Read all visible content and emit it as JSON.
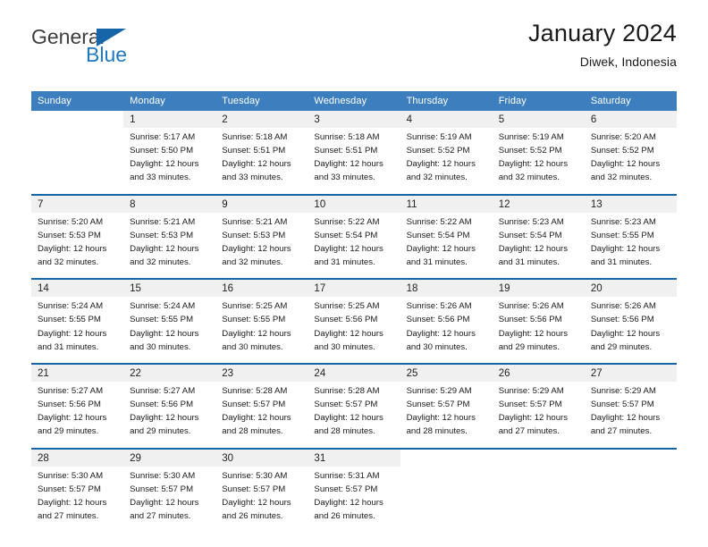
{
  "brand": {
    "name_part1": "General",
    "name_part2": "Blue",
    "flag_icon": "brand-flag-icon"
  },
  "header": {
    "title": "January 2024",
    "location": "Diwek, Indonesia"
  },
  "colors": {
    "header_blue": "#3d7ebf",
    "separator_blue": "#1565a8",
    "daynum_band": "#f0f0f0",
    "brand_blue": "#1f78c1",
    "text": "#1a1a1a"
  },
  "weekday_headers": [
    "Sunday",
    "Monday",
    "Tuesday",
    "Wednesday",
    "Thursday",
    "Friday",
    "Saturday"
  ],
  "weeks": [
    [
      {
        "day": "",
        "sunrise": "",
        "sunset": "",
        "daylight_line1": "",
        "daylight_line2": ""
      },
      {
        "day": "1",
        "sunrise": "Sunrise: 5:17 AM",
        "sunset": "Sunset: 5:50 PM",
        "daylight_line1": "Daylight: 12 hours",
        "daylight_line2": "and 33 minutes."
      },
      {
        "day": "2",
        "sunrise": "Sunrise: 5:18 AM",
        "sunset": "Sunset: 5:51 PM",
        "daylight_line1": "Daylight: 12 hours",
        "daylight_line2": "and 33 minutes."
      },
      {
        "day": "3",
        "sunrise": "Sunrise: 5:18 AM",
        "sunset": "Sunset: 5:51 PM",
        "daylight_line1": "Daylight: 12 hours",
        "daylight_line2": "and 33 minutes."
      },
      {
        "day": "4",
        "sunrise": "Sunrise: 5:19 AM",
        "sunset": "Sunset: 5:52 PM",
        "daylight_line1": "Daylight: 12 hours",
        "daylight_line2": "and 32 minutes."
      },
      {
        "day": "5",
        "sunrise": "Sunrise: 5:19 AM",
        "sunset": "Sunset: 5:52 PM",
        "daylight_line1": "Daylight: 12 hours",
        "daylight_line2": "and 32 minutes."
      },
      {
        "day": "6",
        "sunrise": "Sunrise: 5:20 AM",
        "sunset": "Sunset: 5:52 PM",
        "daylight_line1": "Daylight: 12 hours",
        "daylight_line2": "and 32 minutes."
      }
    ],
    [
      {
        "day": "7",
        "sunrise": "Sunrise: 5:20 AM",
        "sunset": "Sunset: 5:53 PM",
        "daylight_line1": "Daylight: 12 hours",
        "daylight_line2": "and 32 minutes."
      },
      {
        "day": "8",
        "sunrise": "Sunrise: 5:21 AM",
        "sunset": "Sunset: 5:53 PM",
        "daylight_line1": "Daylight: 12 hours",
        "daylight_line2": "and 32 minutes."
      },
      {
        "day": "9",
        "sunrise": "Sunrise: 5:21 AM",
        "sunset": "Sunset: 5:53 PM",
        "daylight_line1": "Daylight: 12 hours",
        "daylight_line2": "and 32 minutes."
      },
      {
        "day": "10",
        "sunrise": "Sunrise: 5:22 AM",
        "sunset": "Sunset: 5:54 PM",
        "daylight_line1": "Daylight: 12 hours",
        "daylight_line2": "and 31 minutes."
      },
      {
        "day": "11",
        "sunrise": "Sunrise: 5:22 AM",
        "sunset": "Sunset: 5:54 PM",
        "daylight_line1": "Daylight: 12 hours",
        "daylight_line2": "and 31 minutes."
      },
      {
        "day": "12",
        "sunrise": "Sunrise: 5:23 AM",
        "sunset": "Sunset: 5:54 PM",
        "daylight_line1": "Daylight: 12 hours",
        "daylight_line2": "and 31 minutes."
      },
      {
        "day": "13",
        "sunrise": "Sunrise: 5:23 AM",
        "sunset": "Sunset: 5:55 PM",
        "daylight_line1": "Daylight: 12 hours",
        "daylight_line2": "and 31 minutes."
      }
    ],
    [
      {
        "day": "14",
        "sunrise": "Sunrise: 5:24 AM",
        "sunset": "Sunset: 5:55 PM",
        "daylight_line1": "Daylight: 12 hours",
        "daylight_line2": "and 31 minutes."
      },
      {
        "day": "15",
        "sunrise": "Sunrise: 5:24 AM",
        "sunset": "Sunset: 5:55 PM",
        "daylight_line1": "Daylight: 12 hours",
        "daylight_line2": "and 30 minutes."
      },
      {
        "day": "16",
        "sunrise": "Sunrise: 5:25 AM",
        "sunset": "Sunset: 5:55 PM",
        "daylight_line1": "Daylight: 12 hours",
        "daylight_line2": "and 30 minutes."
      },
      {
        "day": "17",
        "sunrise": "Sunrise: 5:25 AM",
        "sunset": "Sunset: 5:56 PM",
        "daylight_line1": "Daylight: 12 hours",
        "daylight_line2": "and 30 minutes."
      },
      {
        "day": "18",
        "sunrise": "Sunrise: 5:26 AM",
        "sunset": "Sunset: 5:56 PM",
        "daylight_line1": "Daylight: 12 hours",
        "daylight_line2": "and 30 minutes."
      },
      {
        "day": "19",
        "sunrise": "Sunrise: 5:26 AM",
        "sunset": "Sunset: 5:56 PM",
        "daylight_line1": "Daylight: 12 hours",
        "daylight_line2": "and 29 minutes."
      },
      {
        "day": "20",
        "sunrise": "Sunrise: 5:26 AM",
        "sunset": "Sunset: 5:56 PM",
        "daylight_line1": "Daylight: 12 hours",
        "daylight_line2": "and 29 minutes."
      }
    ],
    [
      {
        "day": "21",
        "sunrise": "Sunrise: 5:27 AM",
        "sunset": "Sunset: 5:56 PM",
        "daylight_line1": "Daylight: 12 hours",
        "daylight_line2": "and 29 minutes."
      },
      {
        "day": "22",
        "sunrise": "Sunrise: 5:27 AM",
        "sunset": "Sunset: 5:56 PM",
        "daylight_line1": "Daylight: 12 hours",
        "daylight_line2": "and 29 minutes."
      },
      {
        "day": "23",
        "sunrise": "Sunrise: 5:28 AM",
        "sunset": "Sunset: 5:57 PM",
        "daylight_line1": "Daylight: 12 hours",
        "daylight_line2": "and 28 minutes."
      },
      {
        "day": "24",
        "sunrise": "Sunrise: 5:28 AM",
        "sunset": "Sunset: 5:57 PM",
        "daylight_line1": "Daylight: 12 hours",
        "daylight_line2": "and 28 minutes."
      },
      {
        "day": "25",
        "sunrise": "Sunrise: 5:29 AM",
        "sunset": "Sunset: 5:57 PM",
        "daylight_line1": "Daylight: 12 hours",
        "daylight_line2": "and 28 minutes."
      },
      {
        "day": "26",
        "sunrise": "Sunrise: 5:29 AM",
        "sunset": "Sunset: 5:57 PM",
        "daylight_line1": "Daylight: 12 hours",
        "daylight_line2": "and 27 minutes."
      },
      {
        "day": "27",
        "sunrise": "Sunrise: 5:29 AM",
        "sunset": "Sunset: 5:57 PM",
        "daylight_line1": "Daylight: 12 hours",
        "daylight_line2": "and 27 minutes."
      }
    ],
    [
      {
        "day": "28",
        "sunrise": "Sunrise: 5:30 AM",
        "sunset": "Sunset: 5:57 PM",
        "daylight_line1": "Daylight: 12 hours",
        "daylight_line2": "and 27 minutes."
      },
      {
        "day": "29",
        "sunrise": "Sunrise: 5:30 AM",
        "sunset": "Sunset: 5:57 PM",
        "daylight_line1": "Daylight: 12 hours",
        "daylight_line2": "and 27 minutes."
      },
      {
        "day": "30",
        "sunrise": "Sunrise: 5:30 AM",
        "sunset": "Sunset: 5:57 PM",
        "daylight_line1": "Daylight: 12 hours",
        "daylight_line2": "and 26 minutes."
      },
      {
        "day": "31",
        "sunrise": "Sunrise: 5:31 AM",
        "sunset": "Sunset: 5:57 PM",
        "daylight_line1": "Daylight: 12 hours",
        "daylight_line2": "and 26 minutes."
      },
      {
        "day": "",
        "sunrise": "",
        "sunset": "",
        "daylight_line1": "",
        "daylight_line2": ""
      },
      {
        "day": "",
        "sunrise": "",
        "sunset": "",
        "daylight_line1": "",
        "daylight_line2": ""
      },
      {
        "day": "",
        "sunrise": "",
        "sunset": "",
        "daylight_line1": "",
        "daylight_line2": ""
      }
    ]
  ]
}
